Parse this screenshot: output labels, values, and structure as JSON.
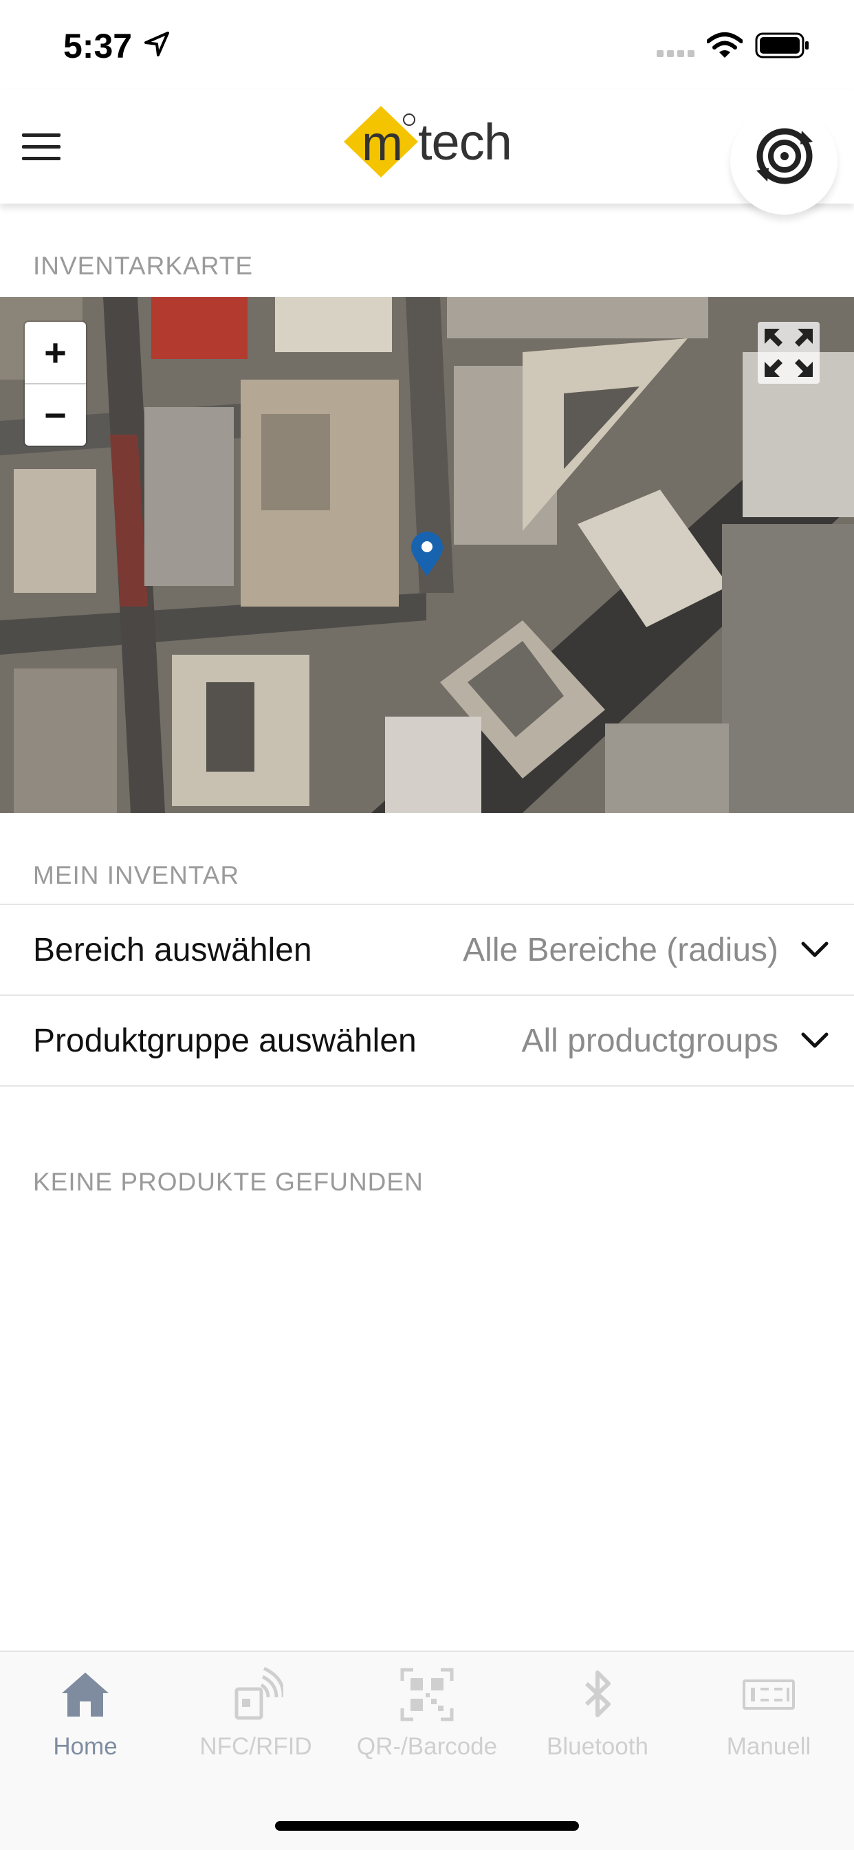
{
  "status_bar": {
    "time": "5:37"
  },
  "header": {
    "brand": "tech",
    "brand_mark": "m"
  },
  "map_section": {
    "title": "INVENTARKARTE"
  },
  "map": {
    "zoom_in": "+",
    "zoom_out": "−"
  },
  "inventory_section": {
    "title": "MEIN INVENTAR"
  },
  "filters": [
    {
      "label": "Bereich auswählen",
      "value": "Alle Bereiche (radius)"
    },
    {
      "label": "Produktgruppe auswählen",
      "value": "All productgroups"
    }
  ],
  "empty_state": "KEINE PRODUKTE GEFUNDEN",
  "tabs": [
    {
      "label": "Home",
      "icon": "home-icon",
      "active": true
    },
    {
      "label": "NFC/RFID",
      "icon": "nfc-icon",
      "active": false
    },
    {
      "label": "QR-/Barcode",
      "icon": "qr-icon",
      "active": false
    },
    {
      "label": "Bluetooth",
      "icon": "bluetooth-icon",
      "active": false
    },
    {
      "label": "Manuell",
      "icon": "keypad-icon",
      "active": false
    }
  ],
  "colors": {
    "brand_yellow": "#f5c400",
    "pin_blue": "#1863b0",
    "tab_active": "#7f8ca0",
    "tab_inactive": "#cfcfcf"
  }
}
